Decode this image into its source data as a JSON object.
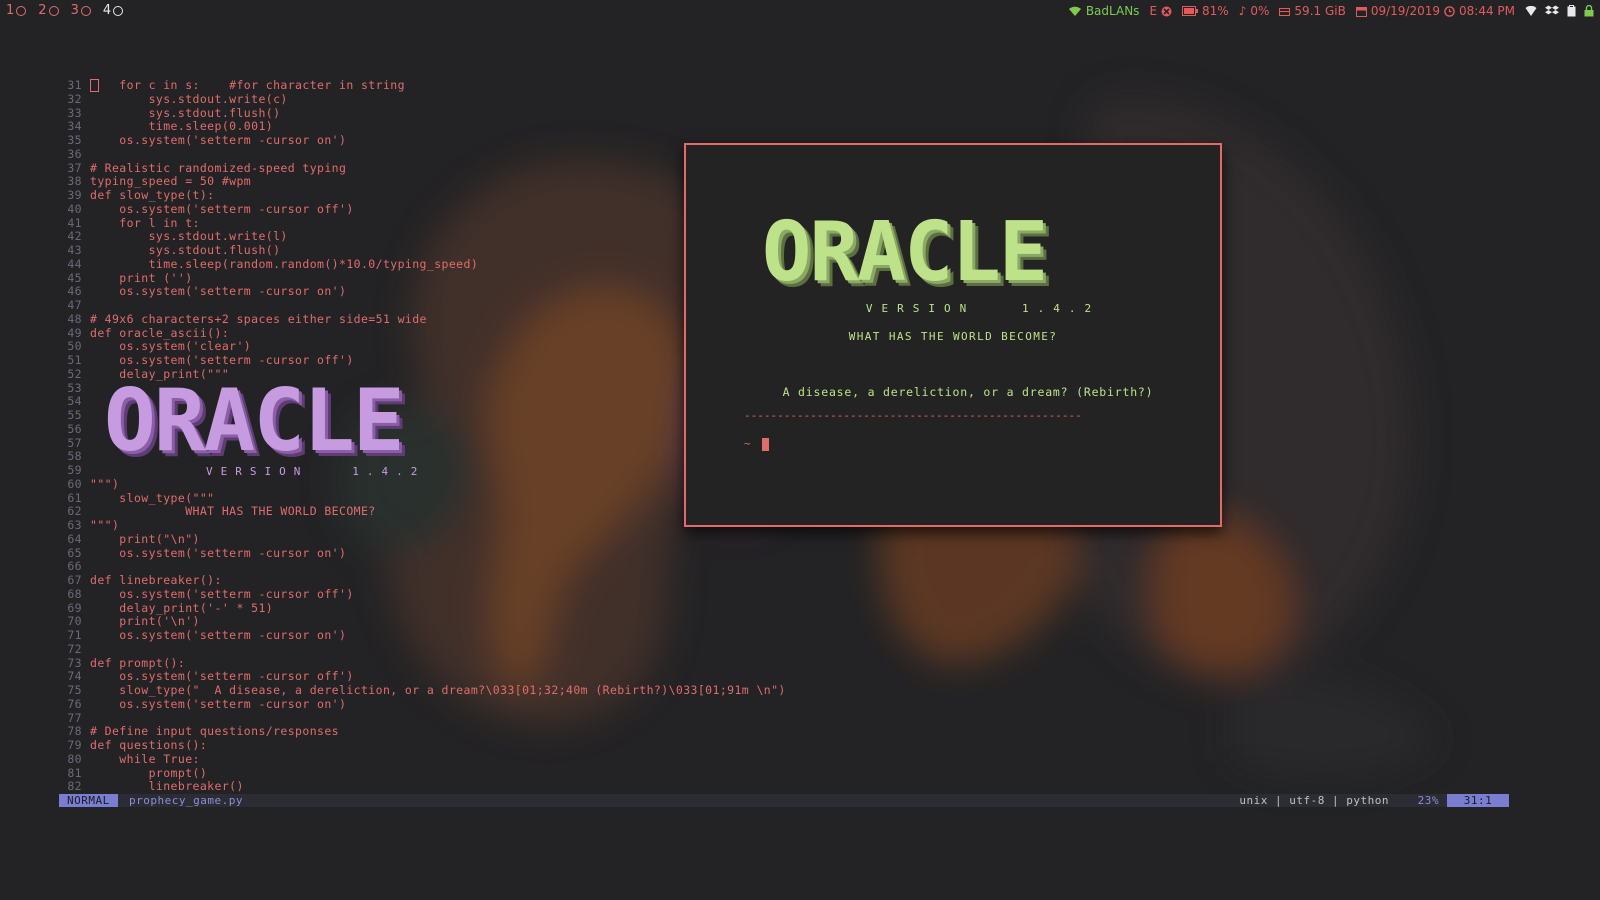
{
  "workspaces": [
    {
      "num": "1",
      "active": false
    },
    {
      "num": "2",
      "active": false
    },
    {
      "num": "3",
      "active": false
    },
    {
      "num": "4",
      "active": true
    }
  ],
  "statusbar": {
    "wifi": "BadLANs",
    "eth": "E",
    "battery": "81%",
    "volume": "0%",
    "disk": "59.1 GiB",
    "date": "09/19/2019",
    "time": "08:44 PM"
  },
  "editor": {
    "lines": [
      {
        "n": "31",
        "text": "    for c in s:    #for character in string",
        "cursor": true
      },
      {
        "n": "32",
        "text": "        sys.stdout.write(c)"
      },
      {
        "n": "33",
        "text": "        sys.stdout.flush()"
      },
      {
        "n": "34",
        "text": "        time.sleep(0.001)"
      },
      {
        "n": "35",
        "text": "    os.system('setterm -cursor on')"
      },
      {
        "n": "36",
        "text": ""
      },
      {
        "n": "37",
        "text": "# Realistic randomized-speed typing"
      },
      {
        "n": "38",
        "text": "typing_speed = 50 #wpm"
      },
      {
        "n": "39",
        "text": "def slow_type(t):"
      },
      {
        "n": "40",
        "text": "    os.system('setterm -cursor off')"
      },
      {
        "n": "41",
        "text": "    for l in t:"
      },
      {
        "n": "42",
        "text": "        sys.stdout.write(l)"
      },
      {
        "n": "43",
        "text": "        sys.stdout.flush()"
      },
      {
        "n": "44",
        "text": "        time.sleep(random.random()*10.0/typing_speed)"
      },
      {
        "n": "45",
        "text": "    print ('')"
      },
      {
        "n": "46",
        "text": "    os.system('setterm -cursor on')"
      },
      {
        "n": "47",
        "text": ""
      },
      {
        "n": "48",
        "text": "# 49x6 characters+2 spaces either side=51 wide"
      },
      {
        "n": "49",
        "text": "def oracle_ascii():"
      },
      {
        "n": "50",
        "text": "    os.system('clear')"
      },
      {
        "n": "51",
        "text": "    os.system('setterm -cursor off')"
      },
      {
        "n": "52",
        "text": "    delay_print(\"\"\""
      },
      {
        "n": "53",
        "text": ""
      },
      {
        "n": "54",
        "text": ""
      },
      {
        "n": "55",
        "text": ""
      },
      {
        "n": "56",
        "text": ""
      },
      {
        "n": "57",
        "text": ""
      },
      {
        "n": "58",
        "text": ""
      },
      {
        "n": "59",
        "text": ""
      },
      {
        "n": "60",
        "text": "\"\"\")"
      },
      {
        "n": "61",
        "text": "    slow_type(\"\"\""
      },
      {
        "n": "62",
        "text": "             WHAT HAS THE WORLD BECOME?"
      },
      {
        "n": "63",
        "text": "\"\"\")"
      },
      {
        "n": "64",
        "text": "    print(\"\\n\")"
      },
      {
        "n": "65",
        "text": "    os.system('setterm -cursor on')"
      },
      {
        "n": "66",
        "text": ""
      },
      {
        "n": "67",
        "text": "def linebreaker():"
      },
      {
        "n": "68",
        "text": "    os.system('setterm -cursor off')"
      },
      {
        "n": "69",
        "text": "    delay_print('-' * 51)"
      },
      {
        "n": "70",
        "text": "    print('\\n')"
      },
      {
        "n": "71",
        "text": "    os.system('setterm -cursor on')"
      },
      {
        "n": "72",
        "text": ""
      },
      {
        "n": "73",
        "text": "def prompt():"
      },
      {
        "n": "74",
        "text": "    os.system('setterm -cursor off')"
      },
      {
        "n": "75",
        "text": "    slow_type(\"  A disease, a dereliction, or a dream?\\033[01;32;40m (Rebirth?)\\033[01;91m \\n\")"
      },
      {
        "n": "76",
        "text": "    os.system('setterm -cursor on')"
      },
      {
        "n": "77",
        "text": ""
      },
      {
        "n": "78",
        "text": "# Define input questions/responses"
      },
      {
        "n": "79",
        "text": "def questions():"
      },
      {
        "n": "80",
        "text": "    while True:"
      },
      {
        "n": "81",
        "text": "        prompt()"
      },
      {
        "n": "82",
        "text": "        linebreaker()"
      }
    ],
    "ascii_title": "ORACLE",
    "ascii_version": "VERSION   1.4.2"
  },
  "vim_status": {
    "mode": "NORMAL",
    "filename": "prophecy_game.py",
    "fileinfo": "unix | utf-8 | python",
    "percent": "23%",
    "position": "31:1"
  },
  "terminal": {
    "title": "ORACLE",
    "version": "VERSION   1.4.2",
    "question": "WHAT HAS THE WORLD BECOME?",
    "prompt": "A disease, a dereliction, or a dream?",
    "rebirth": "(Rebirth?)",
    "divider": "---------------------------------------------------",
    "tilde": "~"
  },
  "colors": {
    "accent_red": "#e26a6a",
    "terminal_green": "#bde28a",
    "vim_mode_blue": "#7a7ed0",
    "ascii_purple": "#c79be0"
  }
}
